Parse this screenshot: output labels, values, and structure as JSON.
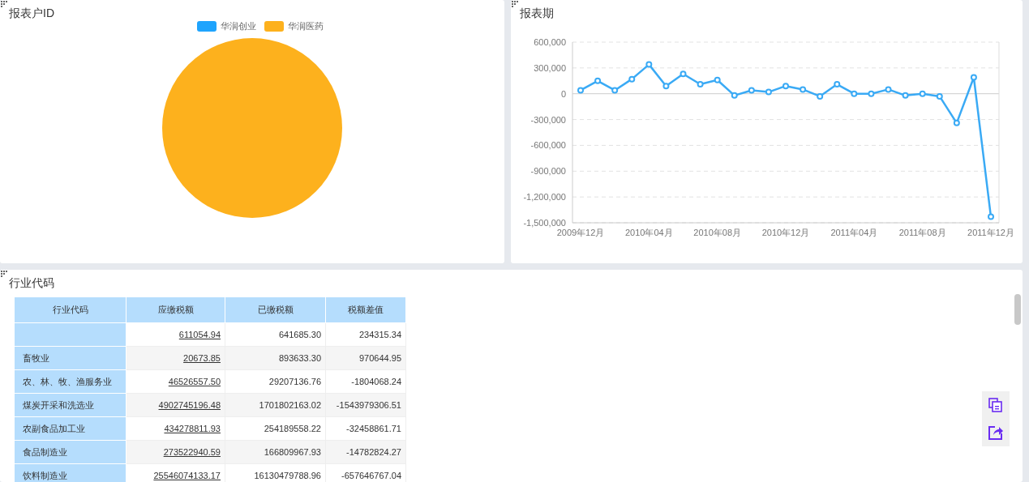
{
  "pie_panel": {
    "title": "报表户ID",
    "chart_data": {
      "type": "pie",
      "categories": [
        "华润创业",
        "华润医药"
      ],
      "values": [
        0,
        1
      ],
      "colors": [
        "#1fa4fd",
        "#fdb11d"
      ]
    }
  },
  "line_panel": {
    "title": "报表期",
    "chart_data": {
      "type": "line",
      "categories": [
        "2009年12月",
        null,
        null,
        null,
        "2010年04月",
        null,
        null,
        null,
        "2010年08月",
        null,
        null,
        null,
        "2010年12月",
        null,
        null,
        null,
        "2011年04月",
        null,
        null,
        null,
        "2011年08月",
        null,
        null,
        null,
        "2011年12月"
      ],
      "grid": true,
      "series": [
        {
          "color": "#3aaaf5",
          "marker": "circle",
          "values": [
            40000,
            150000,
            40000,
            170000,
            340000,
            90000,
            230000,
            110000,
            160000,
            -20000,
            40000,
            20000,
            90000,
            50000,
            -30000,
            110000,
            0,
            0,
            50000,
            -20000,
            0,
            -30000,
            -340000,
            190000,
            -1430000
          ]
        }
      ],
      "ylim": [
        -1500000,
        600000
      ],
      "yticks": [
        {
          "value": 600000,
          "label": "600,000"
        },
        {
          "value": 300000,
          "label": "300,000"
        },
        {
          "value": 0,
          "label": "0"
        },
        {
          "value": -300000,
          "label": "-300,000"
        },
        {
          "value": -600000,
          "label": "-600,000"
        },
        {
          "value": -900000,
          "label": "-900,000"
        },
        {
          "value": -1200000,
          "label": "-1,200,000"
        },
        {
          "value": -1500000,
          "label": "-1,500,000"
        }
      ]
    }
  },
  "table_panel": {
    "title": "行业代码",
    "table": {
      "columns": [
        "行业代码",
        "应缴税额",
        "已缴税额",
        "税额差值"
      ],
      "rows": [
        [
          "",
          "611054.94",
          "641685.30",
          "234315.34"
        ],
        [
          "畜牧业",
          "20673.85",
          "893633.30",
          "970644.95"
        ],
        [
          "农、林、牧、渔服务业",
          "46526557.50",
          "29207136.76",
          "-1804068.24"
        ],
        [
          "煤炭开采和洗选业",
          "4902745196.48",
          "1701802163.02",
          "-1543979306.51"
        ],
        [
          "农副食品加工业",
          "434278811.93",
          "254189558.22",
          "-32458861.71"
        ],
        [
          "食品制造业",
          "273522940.59",
          "166809967.93",
          "-14782824.27"
        ],
        [
          "饮料制造业",
          "25546074133.17",
          "16130479788.96",
          "-657646767.04"
        ]
      ]
    }
  }
}
